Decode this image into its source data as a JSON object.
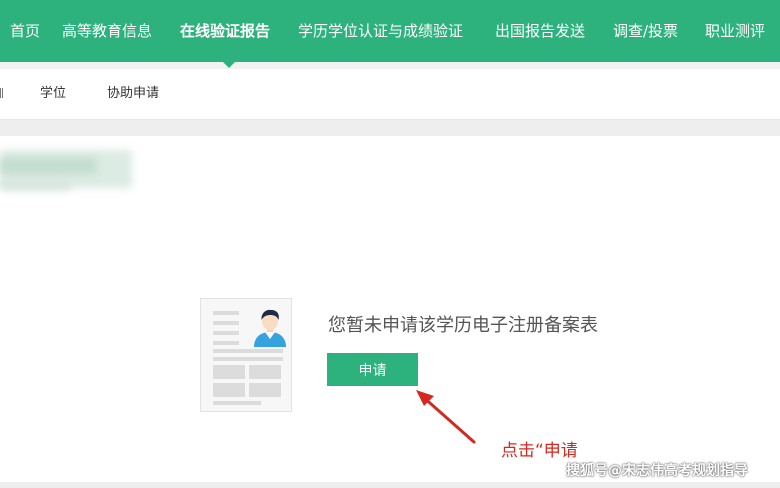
{
  "top_nav": {
    "items": [
      {
        "label": "首页"
      },
      {
        "label": "高等教育信息"
      },
      {
        "label": "在线验证报告",
        "active": true
      },
      {
        "label": "学历学位认证与成绩验证"
      },
      {
        "label": "出国报告发送"
      },
      {
        "label": "调查/投票"
      },
      {
        "label": "职业测评"
      }
    ],
    "bg_color": "#2eb27d"
  },
  "sub_nav": {
    "items": [
      {
        "label": "学位"
      },
      {
        "label": "协助申请"
      }
    ]
  },
  "main": {
    "message": "您暂未申请该学历电子注册备案表",
    "apply_button_label": "申请"
  },
  "annotation": {
    "text": "点击“申请",
    "color": "#d3291f"
  },
  "watermark": "搜狐号@宋志伟高考规划指导",
  "icons": {
    "document": "document-profile-icon",
    "arrow": "red-arrow-icon"
  }
}
